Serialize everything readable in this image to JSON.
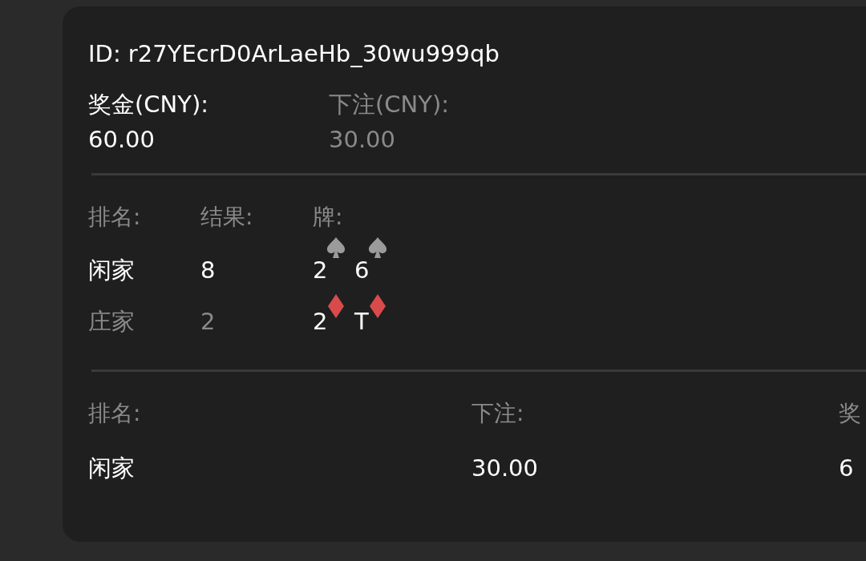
{
  "id_line": "ID: r27YEcrD0ArLaeHb_30wu999qb",
  "stats": [
    {
      "label": "奖金(CNY):",
      "value": "60.00",
      "emphasis": true
    },
    {
      "label": "下注(CNY):",
      "value": "30.00",
      "emphasis": false
    }
  ],
  "result_table": {
    "columns": [
      "排名:",
      "结果:",
      "牌:"
    ],
    "rows": [
      {
        "name": "闲家",
        "result": "8",
        "winner": true,
        "cards": [
          {
            "rank": "2",
            "kind": "spade"
          },
          {
            "rank": "6",
            "kind": "spade"
          }
        ]
      },
      {
        "name": "庄家",
        "result": "2",
        "winner": false,
        "cards": [
          {
            "rank": "2",
            "kind": "diamond"
          },
          {
            "rank": "T",
            "kind": "diamond"
          }
        ]
      }
    ]
  },
  "bet_table": {
    "columns": [
      "排名:",
      "下注:",
      "奖"
    ],
    "rows": [
      [
        "闲家",
        "30.00",
        "6"
      ]
    ]
  }
}
